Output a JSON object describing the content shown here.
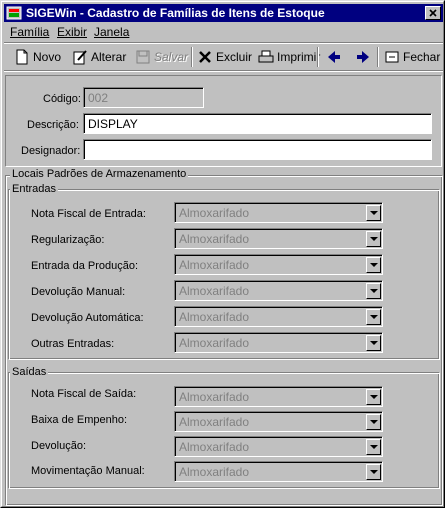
{
  "window": {
    "title": "SIGEWin - Cadastro de Famílias de Itens de Estoque"
  },
  "menu": [
    {
      "label": "Família",
      "accel_index": 0
    },
    {
      "label": "Exibir",
      "accel_index": 0
    },
    {
      "label": "Janela",
      "accel_index": 0
    }
  ],
  "toolbar": {
    "novo": "Novo",
    "alterar": "Alterar",
    "salvar": "Salvar",
    "excluir": "Excluir",
    "imprimir": "Imprimir",
    "fechar": "Fechar"
  },
  "form": {
    "codigo_label": "Código:",
    "codigo_value": "002",
    "descricao_label": "Descrição:",
    "descricao_value": "DISPLAY",
    "designador_label": "Designador:",
    "designador_value": ""
  },
  "locais": {
    "title": "Locais Padrões de Armazenamento",
    "entradas": {
      "title": "Entradas",
      "rows": [
        {
          "label": "Nota Fiscal de Entrada:",
          "value": "Almoxarifado"
        },
        {
          "label": "Regularização:",
          "value": "Almoxarifado"
        },
        {
          "label": "Entrada da Produção:",
          "value": "Almoxarifado"
        },
        {
          "label": "Devolução Manual:",
          "value": "Almoxarifado"
        },
        {
          "label": "Devolução Automática:",
          "value": "Almoxarifado"
        },
        {
          "label": "Outras Entradas:",
          "value": "Almoxarifado"
        }
      ]
    },
    "saidas": {
      "title": "Saídas",
      "rows": [
        {
          "label": "Nota Fiscal de Saída:",
          "value": "Almoxarifado"
        },
        {
          "label": "Baixa de Empenho:",
          "value": "Almoxarifado"
        },
        {
          "label": "Devolução:",
          "value": "Almoxarifado"
        },
        {
          "label": "Movimentação Manual:",
          "value": "Almoxarifado"
        }
      ]
    }
  }
}
